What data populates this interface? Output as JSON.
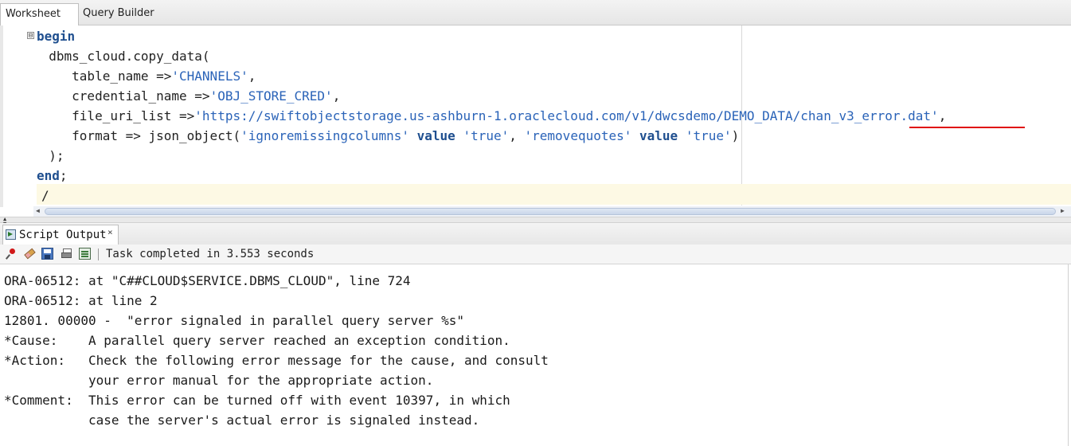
{
  "tabs": {
    "worksheet": "Worksheet",
    "query_builder": "Query Builder"
  },
  "editor": {
    "lines": [
      {
        "kw1": "begin"
      },
      {
        "text1": "  dbms_cloud.copy_data("
      },
      {
        "text1": "     table_name =>",
        "str1": "'CHANNELS'",
        "text2": ","
      },
      {
        "text1": "     credential_name =>",
        "str1": "'OBJ_STORE_CRED'",
        "text2": ","
      },
      {
        "text1": "     file_uri_list =>",
        "str1": "'https://swiftobjectstorage.us-ashburn-1.oraclecloud.com/v1/dwcsdemo/DEMO_DATA/chan_v3_error.dat'",
        "text2": ","
      },
      {
        "text1": "     format => json_object(",
        "str1": "'ignoremissingcolumns'",
        "kw1": " value ",
        "str2": "'true'",
        "text2": ", ",
        "str3": "'removequotes'",
        "kw2": " value ",
        "str4": "'true'",
        "text3": ")"
      },
      {
        "text1": "  );"
      },
      {
        "kw1": "end",
        "text1": ";"
      },
      {
        "text1": "/"
      }
    ],
    "fold_icon": "⊟",
    "highlight_color": "#e01010"
  },
  "output_panel": {
    "tab_label": "Script Output",
    "close_symbol": "×",
    "status": "Task completed in 3.553 seconds",
    "partial_line": "*",
    "lines": [
      "ORA-06512: at \"C##CLOUD$SERVICE.DBMS_CLOUD\", line 724",
      "ORA-06512: at line 2",
      "12801. 00000 -  \"error signaled in parallel query server %s\"",
      "*Cause:    A parallel query server reached an exception condition.",
      "*Action:   Check the following error message for the cause, and consult",
      "           your error manual for the appropriate action.",
      "*Comment:  This error can be turned off with event 10397, in which",
      "           case the server's actual error is signaled instead."
    ]
  },
  "icons": [
    "pin-icon",
    "eraser-icon",
    "save-icon",
    "print-icon",
    "output-icon",
    "script-icon",
    "fold-icon"
  ]
}
